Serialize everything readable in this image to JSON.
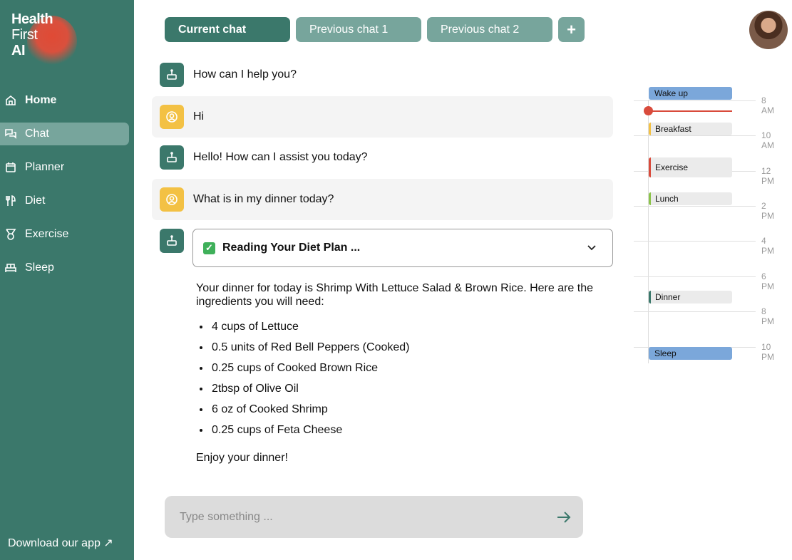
{
  "logo": {
    "line1": "Health",
    "line2": "First",
    "line3": "AI"
  },
  "nav": [
    {
      "label": "Home",
      "icon": "home-icon"
    },
    {
      "label": "Chat",
      "icon": "chat-icon"
    },
    {
      "label": "Planner",
      "icon": "calendar-icon"
    },
    {
      "label": "Diet",
      "icon": "utensils-icon"
    },
    {
      "label": "Exercise",
      "icon": "medal-icon"
    },
    {
      "label": "Sleep",
      "icon": "bed-icon"
    }
  ],
  "download": "Download our app ↗",
  "tabs": [
    "Current chat",
    "Previous chat 1",
    "Previous chat 2",
    "+"
  ],
  "messages": [
    {
      "role": "bot",
      "text": "How can I help you?"
    },
    {
      "role": "user",
      "text": "Hi"
    },
    {
      "role": "bot",
      "text": "Hello! How can I assist you today?"
    },
    {
      "role": "user",
      "text": "What is in my dinner today?"
    }
  ],
  "tool_status": "Reading Your Diet Plan ...",
  "answer": {
    "intro": "Your dinner for today is Shrimp With Lettuce Salad & Brown Rice. Here are the ingredients you will need:",
    "items": [
      "4 cups of Lettuce",
      "0.5 units of Red Bell Peppers (Cooked)",
      "0.25 cups of Cooked Brown Rice",
      "2tbsp of Olive Oil",
      "6 oz of Cooked Shrimp",
      "0.25  cups of Feta Cheese"
    ],
    "outro": "Enjoy your dinner!"
  },
  "input": {
    "placeholder": "Type something ..."
  },
  "schedule": {
    "hours": [
      "8 AM",
      "10 AM",
      "12 PM",
      "2 PM",
      "4 PM",
      "6 PM",
      "8 PM",
      "10 PM"
    ],
    "events": [
      {
        "label": "Wake up",
        "color": "#7ba7da"
      },
      {
        "label": "Breakfast",
        "color": "#f3c144"
      },
      {
        "label": "Exercise",
        "color": "#d94b3c"
      },
      {
        "label": "Lunch",
        "color": "#8bc34a"
      },
      {
        "label": "Dinner",
        "color": "#3b786b"
      },
      {
        "label": "Sleep",
        "color": "#7ba7da"
      }
    ]
  },
  "colors": {
    "primary": "#3b786b",
    "secondary": "#77a59c",
    "user": "#f3c144",
    "now": "#d94b3c"
  }
}
